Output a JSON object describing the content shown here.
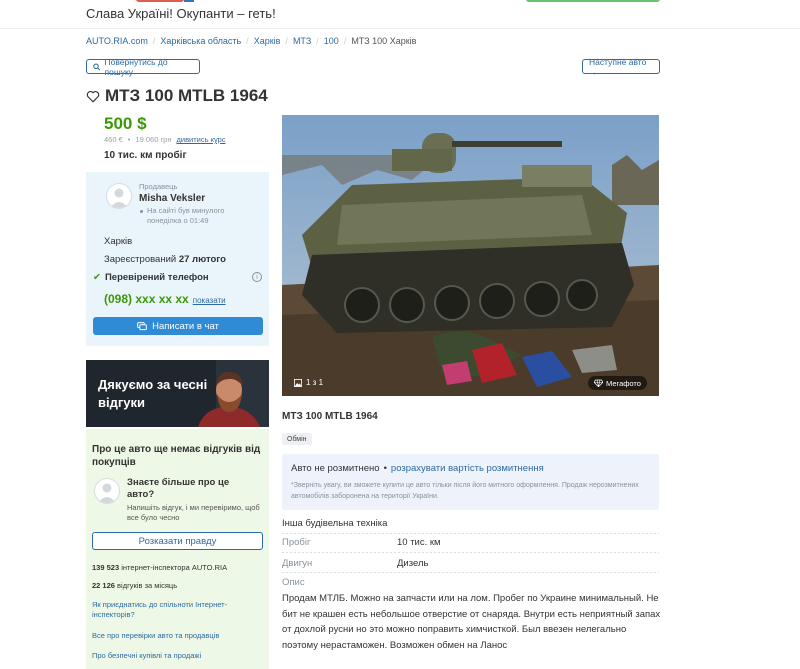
{
  "header": {
    "slogan": "Слава Україні! Окупанти – геть!"
  },
  "breadcrumb": {
    "items": [
      "AUTO.RIA.com",
      "Харківська область",
      "Харків",
      "МТЗ",
      "100"
    ],
    "current": "МТЗ 100 Харків"
  },
  "nav": {
    "back_label": "Повернутись до пошуку",
    "next_label": "Наступне авто →"
  },
  "listing": {
    "title": "МТЗ 100 MTLB 1964",
    "price_usd": "500 $",
    "price_eur": "460 €",
    "price_uah": "19 060 грн",
    "course_link": "дивитись курс",
    "mileage": "10 тис. км пробіг"
  },
  "seller": {
    "caption": "Продавець",
    "name": "Misha Veksler",
    "online": "На сайті був минулого понеділка о 01:49",
    "city": "Харків",
    "registered_label": "Зареєстрований",
    "registered_date": "27 лютого",
    "verified": "Перевірений телефон",
    "phone": "(098) xxx xx xx",
    "phone_show": "показати",
    "chat_button": "Написати в чат"
  },
  "banner": {
    "text": "Дякуємо за чесні відгуки"
  },
  "reviews": {
    "title": "Про це авто ще немає відгуків від покупців",
    "question": "Знаєте більше про це авто?",
    "description": "Напишіть відгук, і ми перевіримо, щоб все було чесно",
    "button": "Розказати правду",
    "stat1_value": "139 523",
    "stat1_text": "інтернет-інспектора AUTO.RIA",
    "stat2_value": "22 126",
    "stat2_text": "відгуків за місяць",
    "link1": "Як приєднатись до спільноти Інтернет-інспекторів?",
    "link2": "Все про перевірки авто та продавців",
    "link3": "Про безпечні купівлі та продажі"
  },
  "photo": {
    "counter": "1 з 1",
    "megaphoto": "Мегафото"
  },
  "details": {
    "subtitle": "МТЗ 100 MTLB 1964",
    "exchange_badge": "Обмін",
    "customs_status": "Авто не розмитнено",
    "customs_calc": "розрахувати вартість розмитнення",
    "customs_note": "*Зверніть увагу, ви зможете купити це авто тільки після його митного оформлення. Продаж нерозмитнених автомобілів заборонена на території України.",
    "category": "Інша будівельна техніка",
    "specs": [
      {
        "label": "Пробіг",
        "value": "10 тис. км"
      },
      {
        "label": "Двигун",
        "value": "Дизель"
      }
    ],
    "desc_label": "Опис",
    "description": "Продам МТЛБ. Можно на запчасти или на лом. Пробег по Украине минимальный. Не бит не крашен есть небольшое отверстие от снаряда. Внутри есть неприятный запах от дохлой русни но это можно поправить химчисткой. Был ввезен нелегально поэтому нерастаможен. Возможен обмен на Ланос"
  },
  "colors": {
    "price_green": "#3c9806",
    "link_blue": "#2d6aa3",
    "chat_blue": "#2f8bd6",
    "seller_bg": "#e9f4fb",
    "reviews_bg": "#eef8e6"
  }
}
